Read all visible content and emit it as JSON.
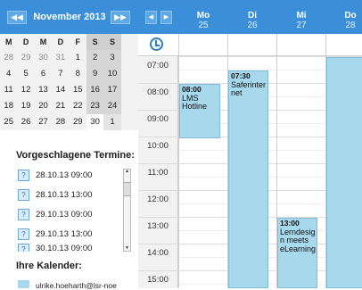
{
  "mini_calendar": {
    "prev_label": "◀◀",
    "next_label": "▶▶",
    "title": "November 2013",
    "weekday_headers": [
      "M",
      "D",
      "M",
      "D",
      "F",
      "S",
      "S"
    ],
    "weeks": [
      [
        "28",
        "29",
        "30",
        "31",
        "1",
        "2",
        "3"
      ],
      [
        "4",
        "5",
        "6",
        "7",
        "8",
        "9",
        "10"
      ],
      [
        "11",
        "12",
        "13",
        "14",
        "15",
        "16",
        "17"
      ],
      [
        "18",
        "19",
        "20",
        "21",
        "22",
        "23",
        "24"
      ],
      [
        "25",
        "26",
        "27",
        "28",
        "29",
        "30",
        "1"
      ]
    ]
  },
  "suggestions": {
    "title": "Vorgeschlagene Termine:",
    "button_label": "?",
    "items": [
      "28.10.13 09:00",
      "28.10.13 13:00",
      "29.10.13 09:00",
      "29.10.13 13:00",
      "30.10.13 09:00"
    ]
  },
  "calendars": {
    "title": "Ihre Kalender:",
    "items": [
      {
        "name": "ulrike.hoeharth@lsr-noe",
        "color": "#a8d8ec"
      }
    ]
  },
  "week": {
    "prev_label": "◀",
    "next_label": "▶",
    "days": [
      {
        "name": "Mo",
        "date": "25"
      },
      {
        "name": "Di",
        "date": "26"
      },
      {
        "name": "Mi",
        "date": "27"
      },
      {
        "name": "Do",
        "date": "28"
      }
    ],
    "times": [
      "07:00",
      "08:00",
      "09:00",
      "10:00",
      "11:00",
      "12:00",
      "13:00",
      "14:00",
      "15:00"
    ],
    "events": [
      {
        "time": "08:00",
        "title": "LMS Hotline"
      },
      {
        "time": "07:30",
        "title": "Saferinter net"
      },
      {
        "time": "13:00",
        "title": "Lerndesig n meets eLearning"
      },
      {
        "time": "",
        "title": ""
      }
    ]
  },
  "colors": {
    "header_blue": "#3a8fd8",
    "event_blue": "#a8d8ec"
  }
}
